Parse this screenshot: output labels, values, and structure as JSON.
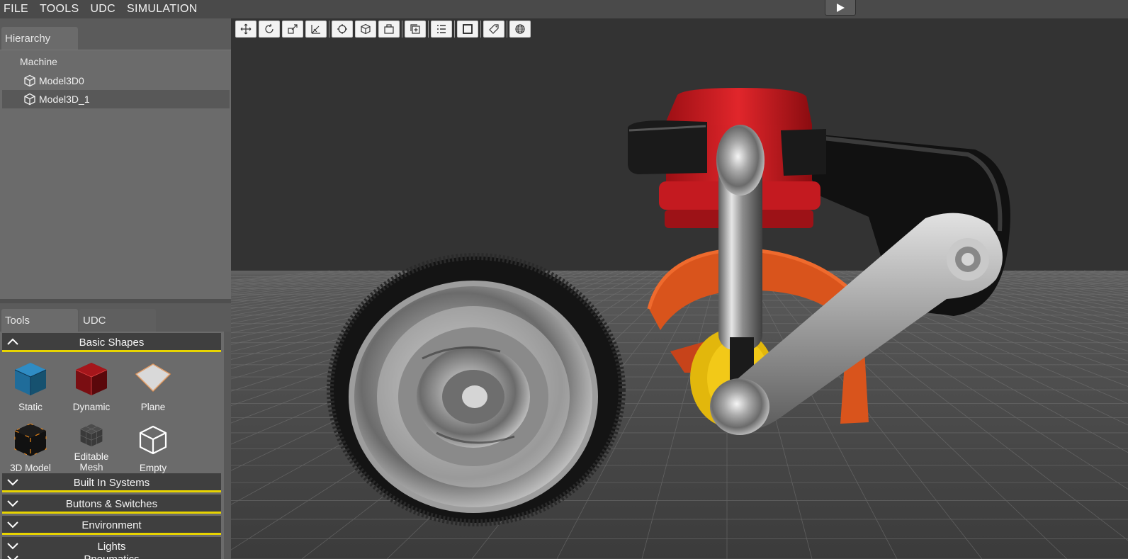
{
  "menu": [
    "FILE",
    "TOOLS",
    "UDC",
    "SIMULATION"
  ],
  "hierarchy": {
    "tab_label": "Hierarchy",
    "root": "Machine",
    "items": [
      {
        "label": "Model3D0",
        "selected": false,
        "icon": "cube-outline-icon"
      },
      {
        "label": "Model3D_1",
        "selected": true,
        "icon": "cube-outline-icon"
      }
    ]
  },
  "tools_panel": {
    "tabs": [
      "Tools",
      "UDC"
    ],
    "active_tab": "Tools",
    "sections": [
      {
        "label": "Basic Shapes",
        "expanded": true
      },
      {
        "label": "Built In Systems",
        "expanded": false
      },
      {
        "label": "Buttons & Switches",
        "expanded": false
      },
      {
        "label": "Environment",
        "expanded": false
      },
      {
        "label": "Lights",
        "expanded": false
      },
      {
        "label": "Pneumatics",
        "expanded": false
      }
    ],
    "basic_shapes": [
      {
        "label": "Static",
        "icon": "blue-cube-icon"
      },
      {
        "label": "Dynamic",
        "icon": "red-cube-icon"
      },
      {
        "label": "Plane",
        "icon": "plane-icon"
      },
      {
        "label": "3D Model",
        "icon": "black-cube-icon"
      },
      {
        "label": "Editable Mesh",
        "icon": "mesh-cube-icon"
      },
      {
        "label": "Empty",
        "icon": "empty-cube-icon"
      }
    ]
  },
  "toolbar": {
    "groups": [
      [
        "move-icon",
        "rotate-icon",
        "scale-icon",
        "transform-icon"
      ],
      [
        "target-icon",
        "cube-view-icon",
        "camera-icon"
      ],
      [
        "duplicate-icon"
      ],
      [
        "list-icon"
      ],
      [
        "frame-icon"
      ],
      [
        "tag-icon"
      ],
      [
        "globe-icon"
      ]
    ]
  },
  "colors": {
    "menubar": "#4a4a4a",
    "panel": "#6b6b6b",
    "section_header": "#3f3f3f",
    "section_accent": "#e8d400",
    "viewport_sky": "#333333",
    "grid_floor": "#4a4a4a"
  }
}
